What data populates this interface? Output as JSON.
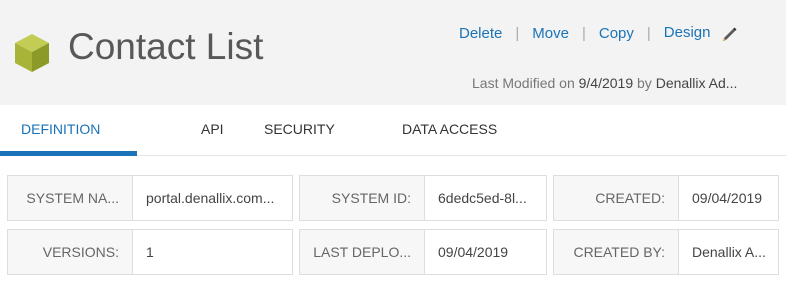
{
  "header": {
    "title": "Contact List",
    "icon": "cube-icon",
    "actions": {
      "delete": "Delete",
      "move": "Move",
      "copy": "Copy",
      "design": "Design",
      "separator": "|"
    },
    "modified": {
      "prefix": "Last Modified on",
      "date": "9/4/2019",
      "by_prefix": "by",
      "user": "Denallix Ad..."
    }
  },
  "tabs": [
    "DEFINITION",
    "API",
    "SECURITY",
    "DATA ACCESS"
  ],
  "active_tab": "DEFINITION",
  "properties": [
    {
      "label": "SYSTEM NA...",
      "value": "portal.denallix.com..."
    },
    {
      "label": "SYSTEM ID:",
      "value": "6dedc5ed-8l..."
    },
    {
      "label": "CREATED:",
      "value": "09/04/2019"
    },
    {
      "label": "VERSIONS:",
      "value": "1"
    },
    {
      "label": "LAST DEPLO...",
      "value": "09/04/2019"
    },
    {
      "label": "CREATED BY:",
      "value": "Denallix A..."
    }
  ],
  "colors": {
    "accent": "#1a73b7",
    "icon_green": "#a8b437",
    "header_bg": "#f3f3f3"
  }
}
